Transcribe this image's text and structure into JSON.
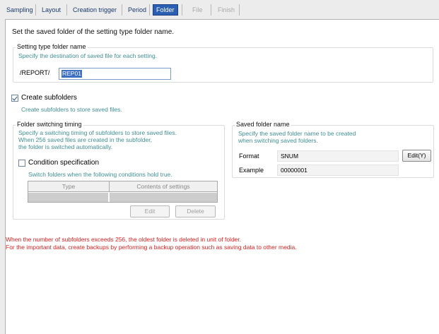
{
  "tabs": [
    {
      "label": "Sampling"
    },
    {
      "label": "Layout"
    },
    {
      "label": "Creation trigger"
    },
    {
      "label": "Period"
    },
    {
      "label": "Folder"
    },
    {
      "label": "File"
    },
    {
      "label": "Finish"
    }
  ],
  "active_tab": "Folder",
  "main": {
    "heading": "Set the saved folder of the setting type folder name."
  },
  "setting_type_folder": {
    "title": "Setting type folder name",
    "hint": "Specify the destination of saved file for each setting.",
    "prefix": "/REPORT/",
    "value": "REP01"
  },
  "create_subfolders": {
    "label": "Create subfolders",
    "checked": true,
    "hint": "Create subfolders to store saved files."
  },
  "folder_switching": {
    "title": "Folder switching timing",
    "hint_lines": [
      "Specify a switching timing of subfolders to store saved files.",
      "When 256 saved files are created in the subfolder,",
      "the folder is switched automatically."
    ],
    "condition_label": "Condition specification",
    "condition_checked": false,
    "condition_hint": "Switch folders when the following conditions hold true.",
    "columns": [
      "Type",
      "Contents of settings"
    ],
    "edit_label": "Edit",
    "delete_label": "Delete"
  },
  "saved_folder_name": {
    "title": "Saved folder name",
    "hint_lines": [
      "Specify the saved folder name to be created",
      "when switching saved folders."
    ],
    "format_label": "Format",
    "format_value": "SNUM",
    "edit_button": "Edit(Y)",
    "example_label": "Example",
    "example_value": "00000001"
  },
  "warnings": [
    "When the number of subfolders exceeds 256, the oldest folder is deleted in unit of folder.",
    "For the important data, create backups by performing a backup operation such as saving data to other media."
  ],
  "colors": {
    "accent": "#2b5fb3",
    "hint": "#3f8f93",
    "warning": "#e02020"
  }
}
